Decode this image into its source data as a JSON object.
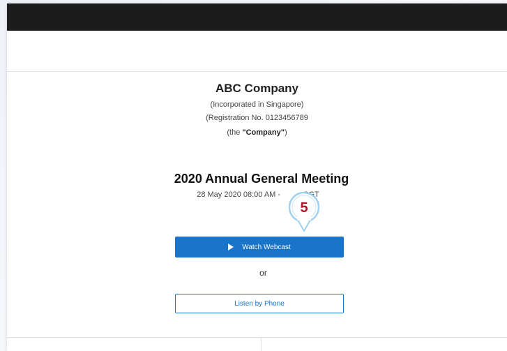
{
  "company": {
    "name": "ABC Company",
    "incorporation": "(Incorporated in Singapore)",
    "registration": "(Registration No. 0123456789",
    "the_prefix": "(the ",
    "the_name": "\"Company\"",
    "the_suffix": ")"
  },
  "meeting": {
    "title": "2020 Annual General Meeting",
    "date": "28 May 2020 08:00 AM - ",
    "date_tail": "SGT"
  },
  "callout": {
    "number": "5",
    "color": "#b5122c"
  },
  "actions": {
    "watch_label": "Watch Webcast",
    "or_label": "or",
    "phone_label": "Listen by Phone"
  },
  "colors": {
    "accent": "#1874c8",
    "topbar": "#1c1c1c"
  }
}
